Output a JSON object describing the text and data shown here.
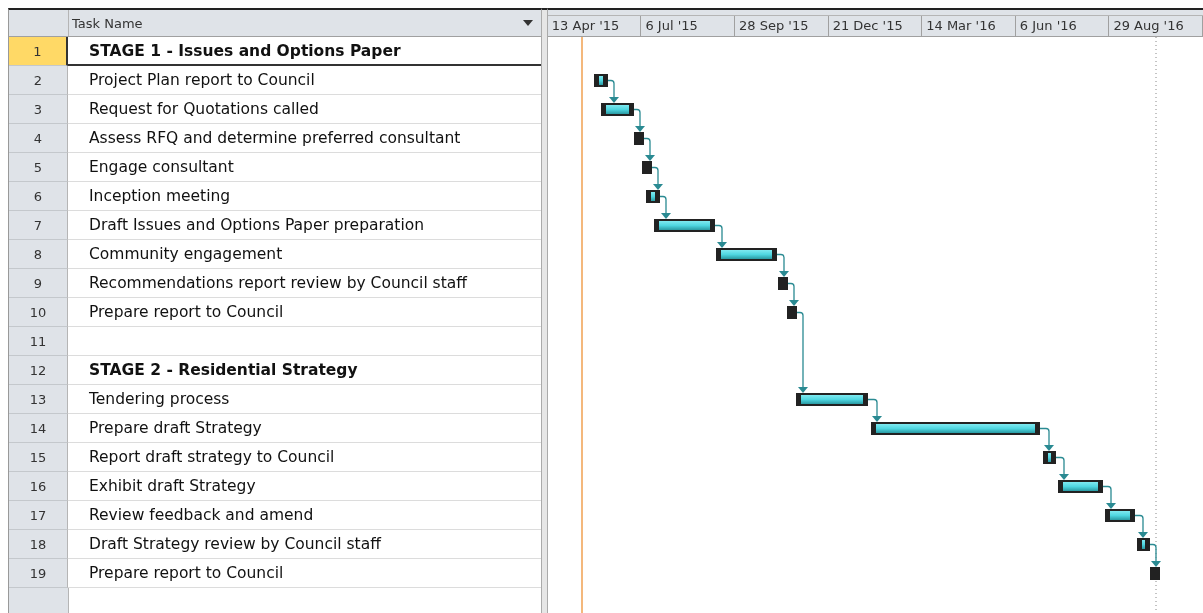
{
  "table": {
    "columns": [
      {
        "label": "Task Name"
      }
    ],
    "rows": [
      {
        "id": "1",
        "name": "STAGE 1 - Issues and Options Paper",
        "kind": "stage",
        "selected": true
      },
      {
        "id": "2",
        "name": "Project Plan report to Council",
        "kind": "task",
        "selected": false
      },
      {
        "id": "3",
        "name": "Request for Quotations called",
        "kind": "task",
        "selected": false
      },
      {
        "id": "4",
        "name": "Assess RFQ and determine preferred consultant",
        "kind": "task",
        "selected": false
      },
      {
        "id": "5",
        "name": "Engage consultant",
        "kind": "task",
        "selected": false
      },
      {
        "id": "6",
        "name": "Inception meeting",
        "kind": "task",
        "selected": false
      },
      {
        "id": "7",
        "name": "Draft Issues and Options Paper preparation",
        "kind": "task",
        "selected": false
      },
      {
        "id": "8",
        "name": "Community engagement",
        "kind": "task",
        "selected": false
      },
      {
        "id": "9",
        "name": "Recommendations report review by Council staff",
        "kind": "task",
        "selected": false
      },
      {
        "id": "10",
        "name": "Prepare report to Council",
        "kind": "task",
        "selected": false
      },
      {
        "id": "11",
        "kind": "blank",
        "selected": false
      },
      {
        "id": "12",
        "name": "STAGE 2 - Residential Strategy",
        "kind": "stage",
        "selected": false
      },
      {
        "id": "13",
        "name": "Tendering process",
        "kind": "task",
        "selected": false
      },
      {
        "id": "14",
        "name": "Prepare draft Strategy",
        "kind": "task",
        "selected": false
      },
      {
        "id": "15",
        "name": "Report draft strategy to Council",
        "kind": "task",
        "selected": false
      },
      {
        "id": "16",
        "name": "Exhibit draft Strategy",
        "kind": "task",
        "selected": false
      },
      {
        "id": "17",
        "name": "Review feedback and amend",
        "kind": "task",
        "selected": false
      },
      {
        "id": "18",
        "name": "Draft Strategy review by Council staff",
        "kind": "task",
        "selected": false
      },
      {
        "id": "19",
        "name": "Prepare report to Council",
        "kind": "task",
        "selected": false
      }
    ]
  },
  "timescale": [
    "13 Apr '15",
    "6 Jul '15",
    "28 Sep '15",
    "21 Dec '15",
    "14 Mar '16",
    "6 Jun '16",
    "29 Aug '16"
  ]
}
